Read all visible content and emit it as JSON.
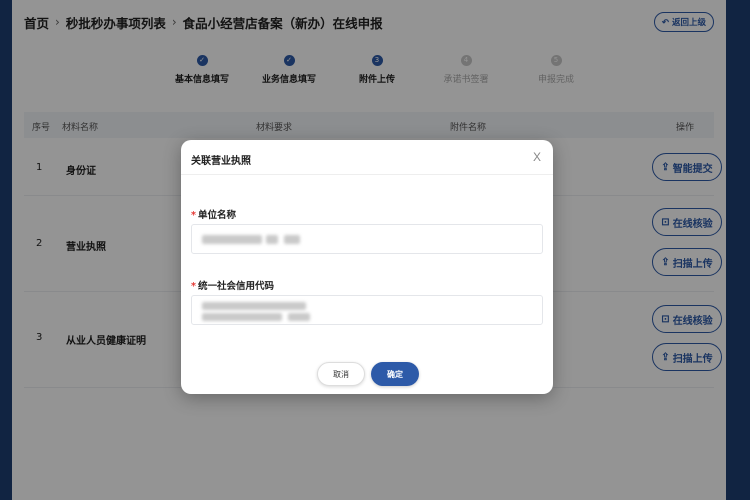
{
  "breadcrumb": {
    "home": "首页",
    "list": "秒批秒办事项列表",
    "current": "食品小经营店备案（新办）在线申报"
  },
  "back_button": {
    "icon": "undo-icon",
    "label": "返回上级"
  },
  "steps": [
    {
      "marker": "✓",
      "label": "基本信息填写",
      "state": "done"
    },
    {
      "marker": "✓",
      "label": "业务信息填写",
      "state": "done"
    },
    {
      "marker": "3",
      "label": "附件上传",
      "state": "active"
    },
    {
      "marker": "4",
      "label": "承诺书签署",
      "state": "todo"
    },
    {
      "marker": "5",
      "label": "申报完成",
      "state": "todo"
    }
  ],
  "table": {
    "headers": {
      "no": "序号",
      "name": "材料名称",
      "req": "材料要求",
      "attach": "附件名称",
      "op": "操作"
    },
    "rows": [
      {
        "no": "1",
        "name": "身份证",
        "ops": [
          "智能提交"
        ]
      },
      {
        "no": "2",
        "name": "营业执照",
        "ops": [
          "在线核验",
          "扫描上传"
        ]
      },
      {
        "no": "3",
        "name": "从业人员健康证明",
        "ops": [
          "在线核验",
          "扫描上传"
        ]
      }
    ]
  },
  "icons": {
    "upload": "upload-icon",
    "verify": "verify-icon",
    "close": "close-icon"
  },
  "modal": {
    "title": "关联营业执照",
    "close": "X",
    "fields": [
      {
        "label": "单位名称",
        "required_mark": "*"
      },
      {
        "label": "统一社会信用代码",
        "required_mark": "*"
      }
    ],
    "cancel_label": "取消",
    "ok_label": "确定"
  },
  "colors": {
    "primary": "#2d5aa8",
    "required": "#e53935",
    "frame": "#1e3f73"
  }
}
